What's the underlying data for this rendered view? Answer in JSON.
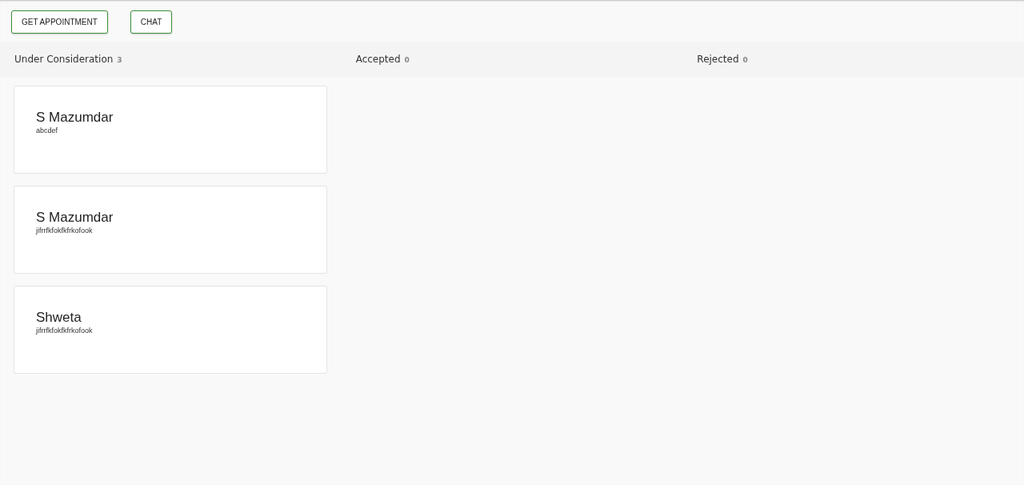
{
  "buttons": [
    {
      "label": "GET APPOINTMENT"
    },
    {
      "label": "CHAT"
    }
  ],
  "lanes": [
    {
      "title": "Under Consideration",
      "count": "3",
      "cards": [
        {
          "name": "S Mazumdar",
          "note": "abcdef"
        },
        {
          "name": "S Mazumdar",
          "note": "jifrrfkfokfkfrkofook"
        },
        {
          "name": "Shweta",
          "note": "jifrrfkfokfkfrkofook"
        }
      ]
    },
    {
      "title": "Accepted",
      "count": "0"
    },
    {
      "title": "Rejected",
      "count": "0"
    }
  ]
}
